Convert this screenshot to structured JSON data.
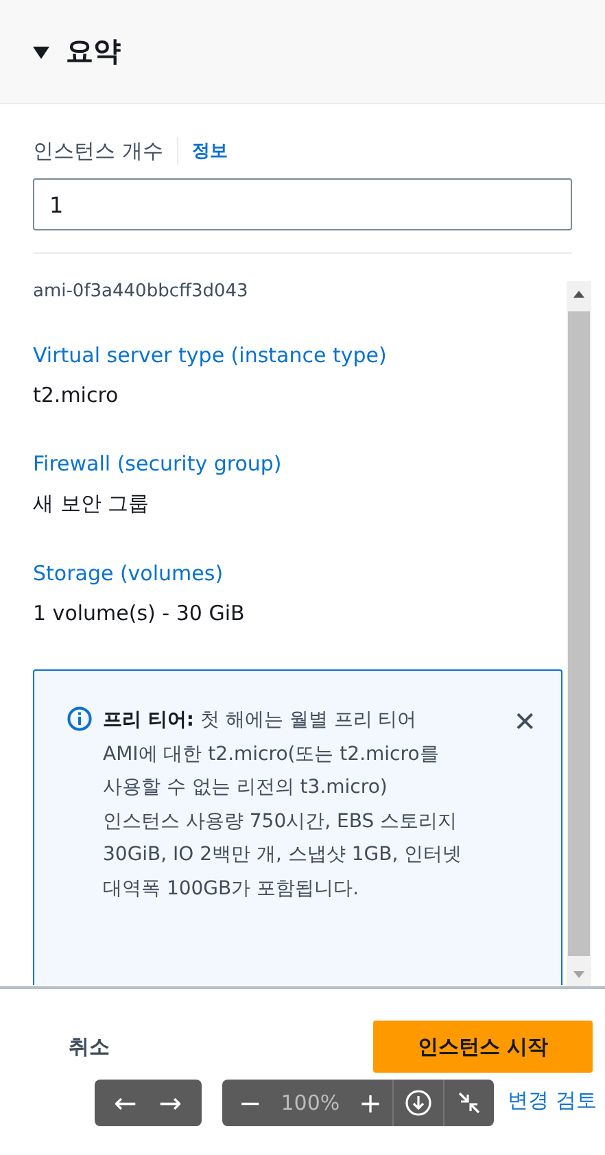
{
  "header": {
    "title": "요약",
    "expanded": true
  },
  "count_field": {
    "label": "인스턴스 개수",
    "info_link": "정보",
    "value": "1"
  },
  "details": {
    "ami": "ami-0f3a440bbcff3d043",
    "items": [
      {
        "label": "Virtual server type (instance type)",
        "value": "t2.micro"
      },
      {
        "label": "Firewall (security group)",
        "value": "새 보안 그룹"
      },
      {
        "label": "Storage (volumes)",
        "value": "1 volume(s) - 30 GiB"
      }
    ]
  },
  "alert": {
    "text": "**프리 티어:** 첫 해에는 월별 프리 티어 AMI에 대한 t2.micro(또는 t2.micro를 사용할 수 없는 리전의 t3.micro) 인스턴스 사용량 750시간, EBS 스토리지 30GiB, IO 2백만 개, 스냅샷 1GB, 인터넷 대역폭 100GB가 포함됩니다.",
    "dismiss": "✕"
  },
  "footer": {
    "cancel": "취소",
    "launch": "인스턴스 시작",
    "review": "변경 검토"
  },
  "viewer_toolbar": {
    "back": "←",
    "forward": "→",
    "zoom_out": "−",
    "zoom": "100%",
    "zoom_in": "+"
  }
}
